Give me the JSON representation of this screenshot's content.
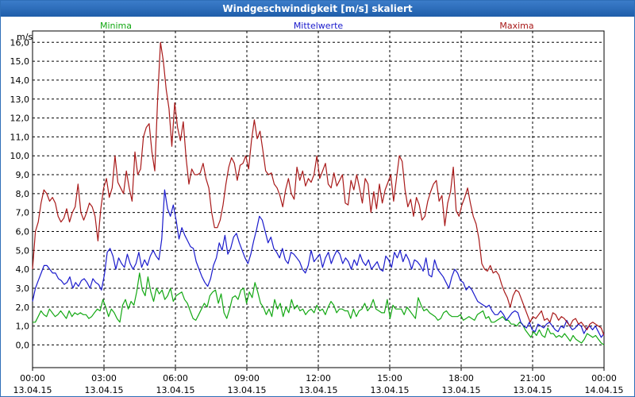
{
  "window": {
    "title": "Windgeschwindigkeit [m/s] skaliert"
  },
  "chart_data": {
    "type": "line",
    "title": "Windgeschwindigkeit [m/s] skaliert",
    "ylabel": "m/s",
    "xlabel": "",
    "ylim": [
      -1.2,
      16.6
    ],
    "xlim": [
      0,
      192
    ],
    "y_ticks": [
      "16,0",
      "15,0",
      "14,0",
      "13,0",
      "12,0",
      "11,0",
      "10,0",
      "9,0",
      "8,0",
      "7,0",
      "6,0",
      "5,0",
      "4,0",
      "3,0",
      "2,0",
      "1,0",
      "0,0"
    ],
    "x_ticks": [
      {
        "time": "00:00",
        "date": "13.04.15"
      },
      {
        "time": "03:00",
        "date": "13.04.15"
      },
      {
        "time": "06:00",
        "date": "13.04.15"
      },
      {
        "time": "09:00",
        "date": "13.04.15"
      },
      {
        "time": "12:00",
        "date": "13.04.15"
      },
      {
        "time": "15:00",
        "date": "13.04.15"
      },
      {
        "time": "18:00",
        "date": "13.04.15"
      },
      {
        "time": "21:00",
        "date": "13.04.15"
      },
      {
        "time": "00:00",
        "date": "14.04.15"
      }
    ],
    "grid": true,
    "series": [
      {
        "name": "Minima",
        "color": "#13a813",
        "values": [
          1.2,
          1.2,
          1.5,
          1.8,
          1.6,
          1.5,
          1.9,
          1.7,
          1.5,
          1.6,
          1.8,
          1.6,
          1.4,
          1.8,
          1.5,
          1.7,
          1.6,
          1.7,
          1.6,
          1.6,
          1.4,
          1.5,
          1.7,
          1.9,
          1.8,
          2.4,
          2.0,
          1.5,
          1.9,
          1.7,
          1.4,
          1.2,
          2.1,
          2.4,
          1.9,
          2.3,
          2.1,
          2.8,
          3.8,
          2.9,
          2.6,
          3.6,
          2.8,
          2.3,
          3.0,
          2.7,
          2.9,
          2.4,
          2.6,
          3.0,
          2.3,
          2.6,
          2.7,
          2.8,
          2.4,
          2.2,
          1.8,
          1.4,
          1.3,
          1.6,
          1.9,
          2.2,
          2.0,
          2.6,
          2.8,
          2.9,
          2.2,
          2.7,
          1.7,
          1.4,
          1.9,
          2.5,
          2.6,
          2.4,
          2.9,
          3.0,
          2.2,
          2.8,
          2.5,
          3.3,
          2.8,
          2.2,
          2.0,
          1.6,
          1.9,
          1.5,
          2.4,
          1.9,
          2.2,
          1.5,
          2.0,
          1.7,
          2.4,
          1.9,
          2.1,
          1.8,
          1.9,
          1.6,
          1.8,
          1.9,
          1.7,
          2.1,
          1.8,
          1.9,
          1.6,
          2.0,
          2.3,
          2.1,
          1.7,
          1.9,
          1.9,
          1.8,
          1.8,
          1.4,
          1.9,
          1.5,
          1.8,
          1.9,
          2.2,
          1.8,
          2.0,
          2.4,
          1.9,
          1.8,
          1.7,
          1.7,
          2.4,
          1.4,
          2.1,
          1.9,
          1.9,
          1.9,
          1.6,
          2.0,
          1.8,
          1.6,
          1.4,
          2.5,
          2.1,
          1.8,
          1.9,
          1.7,
          1.6,
          1.5,
          1.3,
          1.4,
          1.7,
          1.8,
          1.6,
          1.5,
          1.5,
          1.5,
          1.6,
          1.3,
          1.4,
          1.5,
          1.4,
          1.3,
          1.6,
          1.7,
          1.8,
          1.4,
          1.5,
          1.2,
          1.2,
          1.3,
          1.4,
          1.5,
          1.3,
          1.3,
          1.1,
          1.1,
          1.0,
          1.2,
          1.1,
          0.8,
          0.6,
          0.4,
          0.7,
          0.5,
          0.8,
          0.5,
          0.4,
          0.9,
          0.6,
          0.6,
          0.4,
          0.5,
          0.4,
          0.6,
          0.4,
          0.2,
          0.5,
          0.3,
          0.2,
          0.1,
          0.3,
          0.6,
          0.5,
          0.4,
          0.5,
          0.3,
          0.1,
          0.0
        ]
      },
      {
        "name": "Mittelwerte",
        "color": "#1a1acc",
        "values": [
          2.3,
          3.0,
          3.4,
          3.8,
          4.2,
          4.2,
          4.0,
          3.8,
          3.8,
          3.5,
          3.4,
          3.2,
          3.3,
          3.6,
          3.0,
          3.3,
          3.1,
          3.4,
          3.5,
          3.3,
          3.0,
          3.5,
          3.3,
          3.2,
          2.9,
          3.7,
          4.9,
          5.1,
          4.7,
          4.0,
          4.6,
          4.3,
          4.1,
          4.8,
          4.3,
          4.0,
          4.3,
          4.9,
          4.1,
          4.5,
          4.2,
          4.7,
          5.0,
          4.7,
          4.5,
          5.6,
          8.2,
          7.2,
          6.8,
          7.4,
          6.6,
          5.6,
          6.2,
          5.8,
          5.5,
          5.2,
          5.1,
          4.4,
          4.0,
          3.6,
          3.3,
          3.1,
          3.5,
          4.2,
          4.6,
          5.4,
          5.0,
          5.8,
          4.8,
          5.1,
          5.7,
          5.9,
          5.4,
          5.0,
          4.6,
          4.3,
          4.8,
          5.5,
          6.1,
          6.8,
          6.6,
          6.0,
          5.4,
          5.7,
          5.1,
          4.9,
          4.6,
          5.1,
          4.5,
          4.3,
          4.9,
          4.8,
          4.6,
          4.4,
          4.0,
          3.8,
          4.2,
          5.0,
          4.4,
          4.6,
          4.8,
          4.1,
          4.6,
          4.9,
          4.3,
          4.7,
          5.0,
          4.8,
          4.3,
          4.6,
          4.4,
          4.0,
          4.5,
          4.2,
          4.8,
          4.4,
          4.2,
          4.5,
          4.0,
          4.2,
          4.4,
          4.0,
          3.9,
          4.7,
          4.5,
          4.1,
          4.9,
          4.6,
          5.0,
          4.4,
          4.8,
          4.5,
          4.0,
          4.5,
          4.4,
          4.2,
          3.9,
          4.6,
          3.7,
          3.6,
          4.5,
          4.0,
          3.8,
          3.6,
          3.3,
          3.0,
          3.6,
          4.0,
          3.8,
          3.4,
          3.3,
          2.9,
          3.1,
          2.9,
          2.6,
          2.3,
          2.2,
          2.1,
          2.0,
          2.1,
          1.8,
          1.6,
          1.6,
          1.8,
          1.6,
          1.3,
          1.5,
          1.7,
          1.8,
          1.7,
          1.2,
          1.0,
          0.9,
          1.2,
          0.8,
          0.7,
          1.1,
          1.0,
          0.9,
          1.1,
          1.2,
          1.0,
          0.8,
          0.7,
          1.0,
          0.9,
          1.3,
          1.0,
          0.8,
          0.9,
          1.1,
          1.0,
          0.6,
          0.9,
          1.0,
          0.8,
          1.0,
          0.7,
          0.4,
          0.6
        ]
      },
      {
        "name": "Maxima",
        "color": "#a81919",
        "values": [
          4.0,
          6.0,
          6.5,
          7.5,
          8.2,
          8.0,
          7.6,
          7.8,
          7.5,
          6.8,
          6.5,
          6.7,
          7.2,
          6.5,
          7.0,
          7.3,
          8.5,
          7.0,
          6.6,
          7.0,
          7.5,
          7.3,
          6.8,
          5.5,
          7.2,
          8.3,
          8.8,
          7.8,
          8.3,
          10.0,
          8.6,
          8.3,
          8.0,
          9.2,
          8.3,
          7.6,
          10.2,
          9.0,
          9.3,
          11.0,
          11.5,
          11.7,
          10.2,
          9.2,
          13.0,
          16.0,
          15.0,
          13.5,
          12.5,
          10.5,
          12.8,
          11.5,
          10.8,
          11.8,
          9.9,
          8.5,
          9.3,
          9.0,
          9.0,
          9.1,
          9.6,
          8.8,
          8.3,
          7.0,
          6.2,
          6.2,
          6.6,
          7.4,
          8.5,
          9.4,
          9.9,
          9.6,
          8.7,
          9.5,
          9.6,
          10.0,
          9.3,
          10.8,
          11.9,
          10.9,
          11.3,
          10.3,
          9.2,
          9.0,
          9.1,
          8.5,
          8.3,
          7.9,
          7.3,
          8.2,
          8.8,
          8.0,
          7.7,
          9.4,
          8.7,
          9.2,
          8.4,
          8.8,
          8.6,
          9.0,
          10.0,
          8.8,
          9.2,
          9.6,
          8.5,
          8.3,
          9.1,
          8.4,
          8.7,
          9.0,
          7.5,
          7.4,
          8.7,
          8.2,
          9.0,
          8.3,
          7.5,
          8.8,
          8.5,
          7.0,
          8.1,
          7.2,
          8.5,
          7.5,
          8.2,
          8.6,
          9.0,
          7.6,
          8.8,
          10.0,
          9.7,
          8.2,
          7.3,
          7.7,
          6.8,
          7.8,
          7.4,
          6.6,
          6.8,
          7.6,
          8.1,
          8.5,
          8.7,
          7.6,
          7.9,
          6.3,
          7.5,
          8.1,
          9.4,
          7.1,
          6.8,
          7.4,
          7.8,
          8.3,
          7.5,
          6.8,
          6.4,
          5.6,
          4.3,
          4.0,
          3.9,
          4.2,
          3.8,
          3.9,
          3.7,
          3.2,
          2.8,
          2.5,
          2.0,
          2.6,
          2.9,
          2.8,
          2.4,
          2.0,
          1.6,
          1.2,
          1.5,
          1.4,
          1.6,
          1.8,
          1.3,
          1.4,
          1.2,
          1.7,
          1.6,
          1.3,
          1.5,
          1.4,
          1.2,
          1.0,
          1.3,
          1.4,
          1.1,
          1.2,
          1.0,
          0.8,
          1.1,
          1.2,
          1.1,
          1.0,
          0.9,
          0.5
        ]
      }
    ]
  }
}
